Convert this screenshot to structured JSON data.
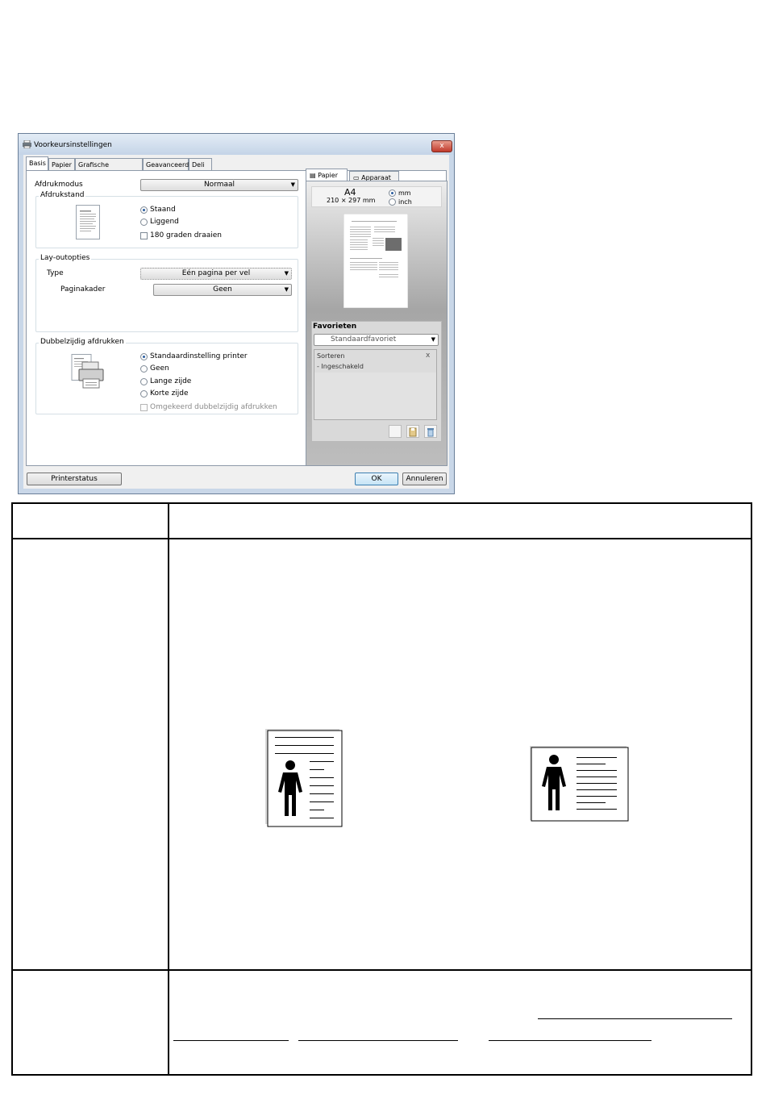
{
  "window": {
    "title": "Voorkeursinstellingen",
    "close_glyph": "x"
  },
  "tabs": [
    "Basis",
    "Papier",
    "Grafische elementen",
    "Geavanceerd",
    "Deli"
  ],
  "basis": {
    "print_mode_label": "Afdrukmodus",
    "print_mode_value": "Normaal",
    "orientation": {
      "group_label": "Afdrukstand",
      "options": [
        {
          "label": "Staand",
          "selected": true
        },
        {
          "label": "Liggend",
          "selected": false
        }
      ],
      "rotate_label": "180 graden draaien",
      "rotate_checked": false
    },
    "layout": {
      "group_label": "Lay-outopties",
      "type_label": "Type",
      "type_value": "Eén pagina per vel",
      "border_label": "Paginakader",
      "border_value": "Geen"
    },
    "duplex": {
      "group_label": "Dubbelzijdig afdrukken",
      "options": [
        {
          "label": "Standaardinstelling printer",
          "selected": true
        },
        {
          "label": "Geen",
          "selected": false
        },
        {
          "label": "Lange zijde",
          "selected": false
        },
        {
          "label": "Korte zijde",
          "selected": false
        }
      ],
      "reverse_label": "Omgekeerd dubbelzijdig afdrukken",
      "reverse_checked": false
    }
  },
  "preview": {
    "tab_paper": "Papier",
    "tab_device": "Apparaat",
    "paper_size": "A4",
    "paper_dims": "210 × 297 mm",
    "unit_mm": "mm",
    "unit_inch": "inch",
    "unit_selected": "mm"
  },
  "favorites": {
    "header": "Favorieten",
    "selected": "Standaardfavoriet",
    "list_title": "Sorteren",
    "list_item": "- Ingeschakeld",
    "remove_glyph": "x"
  },
  "footer": {
    "printer_status": "Printerstatus",
    "ok": "OK",
    "cancel": "Annuleren"
  },
  "colors": {
    "accent": "#2a5da0",
    "close": "#c0392b"
  }
}
